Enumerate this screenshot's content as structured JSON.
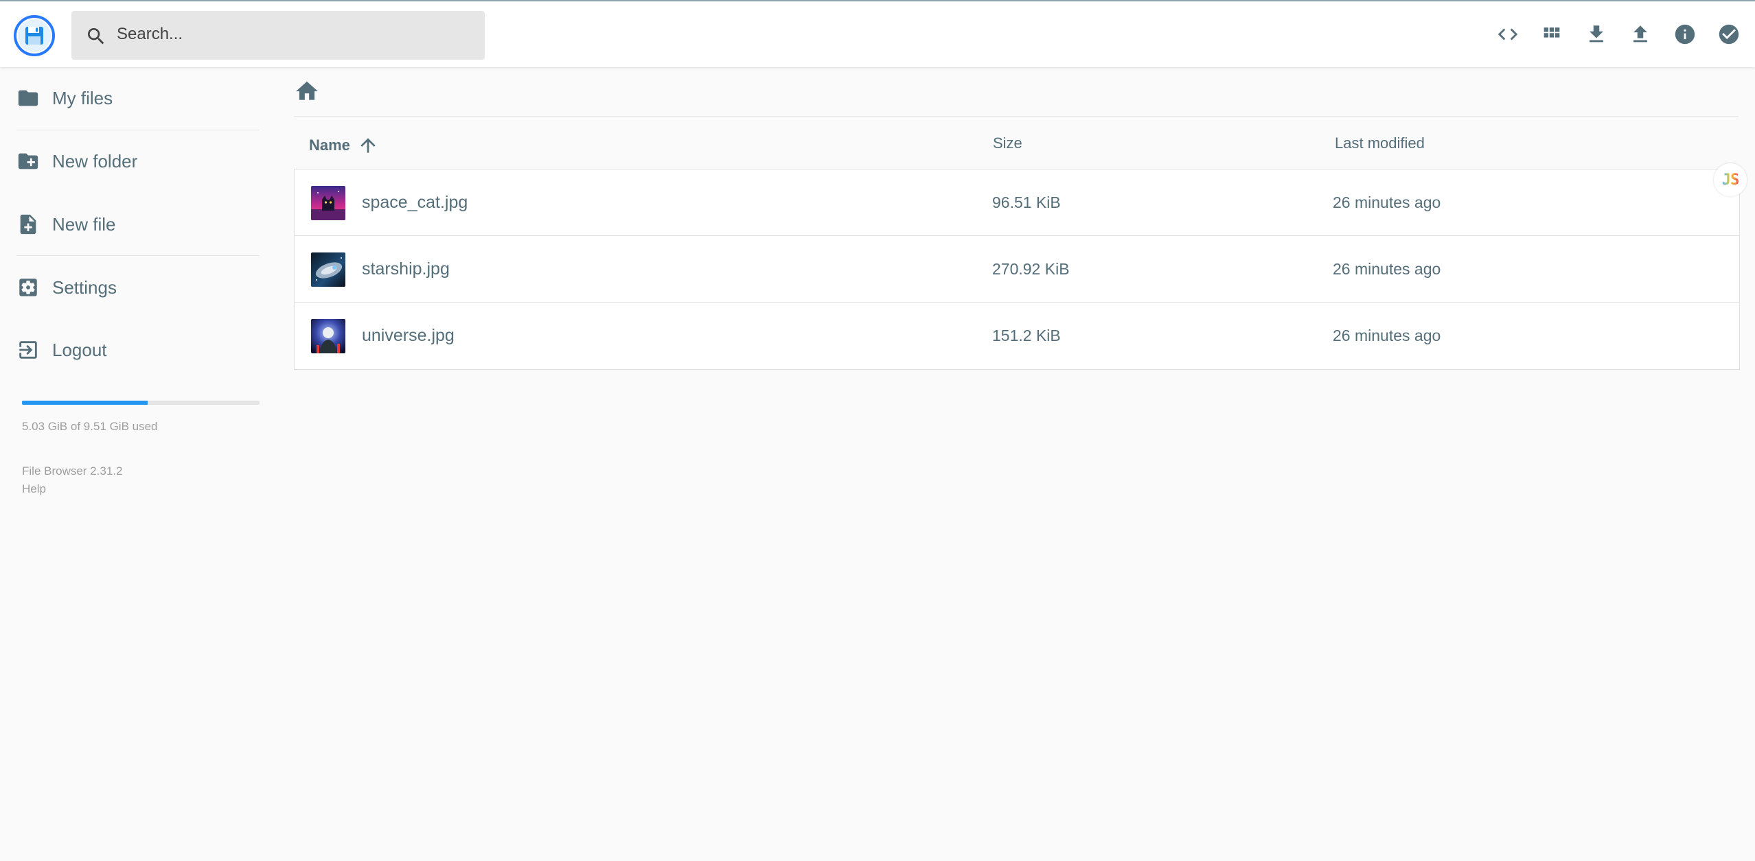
{
  "header": {
    "search_placeholder": "Search...",
    "actions": [
      {
        "name": "code-icon",
        "title": "Toggle view"
      },
      {
        "name": "grid-view-icon",
        "title": "Switch view"
      },
      {
        "name": "download-icon",
        "title": "Download"
      },
      {
        "name": "upload-icon",
        "title": "Upload"
      },
      {
        "name": "info-icon",
        "title": "Info"
      },
      {
        "name": "select-check-icon",
        "title": "Select multiple"
      }
    ]
  },
  "sidebar": {
    "items": [
      {
        "label": "My files",
        "icon": "folder-icon"
      },
      {
        "label": "New folder",
        "icon": "create-new-folder-icon"
      },
      {
        "label": "New file",
        "icon": "note-add-icon"
      },
      {
        "label": "Settings",
        "icon": "settings-applications-icon"
      },
      {
        "label": "Logout",
        "icon": "exit-to-app-icon"
      }
    ],
    "usage": {
      "text": "5.03 GiB of 9.51 GiB used",
      "fraction": 0.529
    },
    "version": "File Browser 2.31.2",
    "help": "Help"
  },
  "table": {
    "columns": {
      "name": "Name",
      "size": "Size",
      "modified": "Last modified"
    },
    "sort": "name-ascending",
    "rows": [
      {
        "name": "space_cat.jpg",
        "size": "96.51 KiB",
        "modified": "26 minutes ago"
      },
      {
        "name": "starship.jpg",
        "size": "270.92 KiB",
        "modified": "26 minutes ago"
      },
      {
        "name": "universe.jpg",
        "size": "151.2 KiB",
        "modified": "26 minutes ago"
      }
    ]
  },
  "colors": {
    "accent": "#2196f3",
    "icon": "#546e7a",
    "background": "#fafafa",
    "search_bg": "#e6e6e6"
  },
  "side_badge": "JS"
}
